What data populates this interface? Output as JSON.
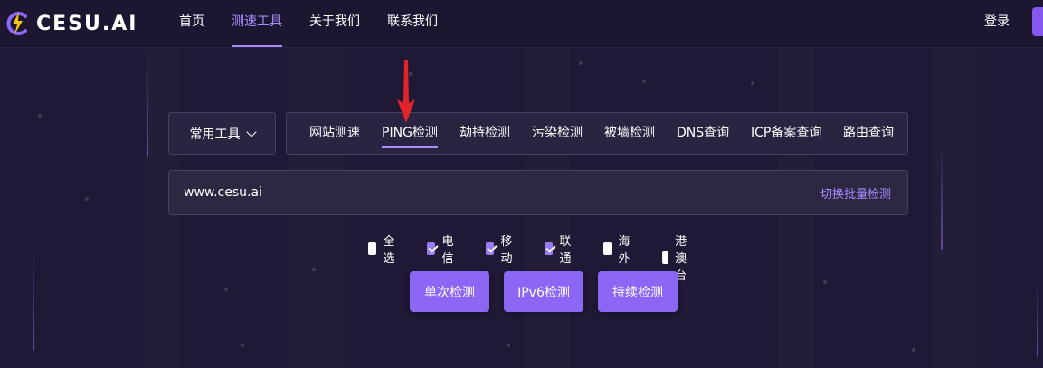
{
  "header": {
    "logo_text": "CESU.AI",
    "nav": [
      "首页",
      "测速工具",
      "关于我们",
      "联系我们"
    ],
    "active_nav_index": 1,
    "login_label": "登录"
  },
  "tools": {
    "dropdown_label": "常用工具",
    "tabs": [
      "网站测速",
      "PING检测",
      "劫持检测",
      "污染检测",
      "被墙检测",
      "DNS查询",
      "ICP备案查询",
      "路由查询"
    ],
    "active_tab_index": 1
  },
  "url_input": {
    "value": "www.cesu.ai",
    "batch_link": "切换批量检测"
  },
  "checkboxes": [
    {
      "label": "全选",
      "checked": false
    },
    {
      "label": "电信",
      "checked": true
    },
    {
      "label": "移动",
      "checked": true
    },
    {
      "label": "联通",
      "checked": true
    },
    {
      "label": "海外",
      "checked": false
    },
    {
      "label": "港澳台",
      "checked": false
    }
  ],
  "buttons": [
    "单次检测",
    "IPv6检测",
    "持续检测"
  ],
  "colors": {
    "background": "#1f1935",
    "accent": "#a98cff",
    "button": "#8c66f5",
    "arrow": "#e0242a",
    "logo_bolt": "#f5c518"
  }
}
